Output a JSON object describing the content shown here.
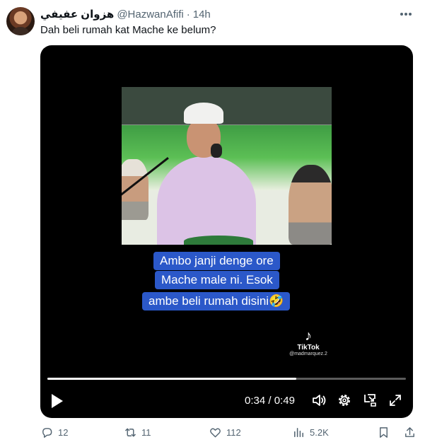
{
  "tweet": {
    "display_name": "هزوان عفيفي",
    "handle": "@HazwanAfifi",
    "separator": "·",
    "time": "14h",
    "text": "Dah beli rumah kat Mache ke belum?"
  },
  "video": {
    "captions": [
      "Ambo janji denge ore",
      "Mache male ni. Esok",
      "ambe beli rumah disini🤣"
    ],
    "watermark": {
      "label": "TikTok",
      "handle": "@madmarquez.2"
    },
    "progress_fraction": 0.694,
    "current_time": "0:34",
    "time_separator": "/",
    "duration": "0:49",
    "controls": [
      "play-icon",
      "volume-icon",
      "settings-icon",
      "pip-icon",
      "fullscreen-icon"
    ]
  },
  "actions": {
    "replies": "12",
    "retweets": "11",
    "likes": "112",
    "views": "5.2K"
  },
  "colors": {
    "text": "#0f1419",
    "muted": "#536471",
    "caption_bg": "#2b58c9",
    "video_bg": "#000000"
  }
}
